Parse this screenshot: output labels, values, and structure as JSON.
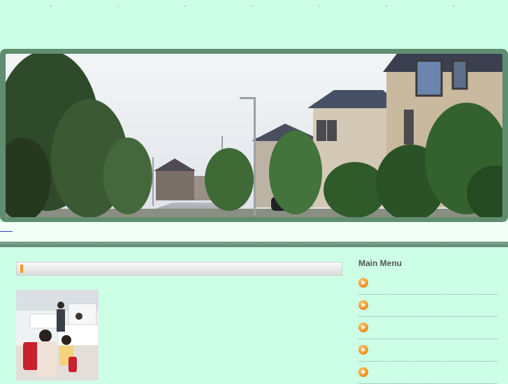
{
  "header": {
    "banner_alt": "",
    "link_text": ""
  },
  "main": {
    "content_title": ""
  },
  "sidebar": {
    "heading": "Main Menu",
    "items": [
      {
        "label": ""
      },
      {
        "label": ""
      },
      {
        "label": ""
      },
      {
        "label": ""
      },
      {
        "label": ""
      }
    ]
  },
  "colors": {
    "page_background": "#ccffe6",
    "banner_frame": "#5f8d6f",
    "divider": "#6e9a7e",
    "menu_bullet": "#f08a1a",
    "heading_text": "#555555"
  },
  "icons": {
    "menu_bullet": "orange-circle-arrow-icon",
    "title_marker": "orange-bar-icon"
  }
}
